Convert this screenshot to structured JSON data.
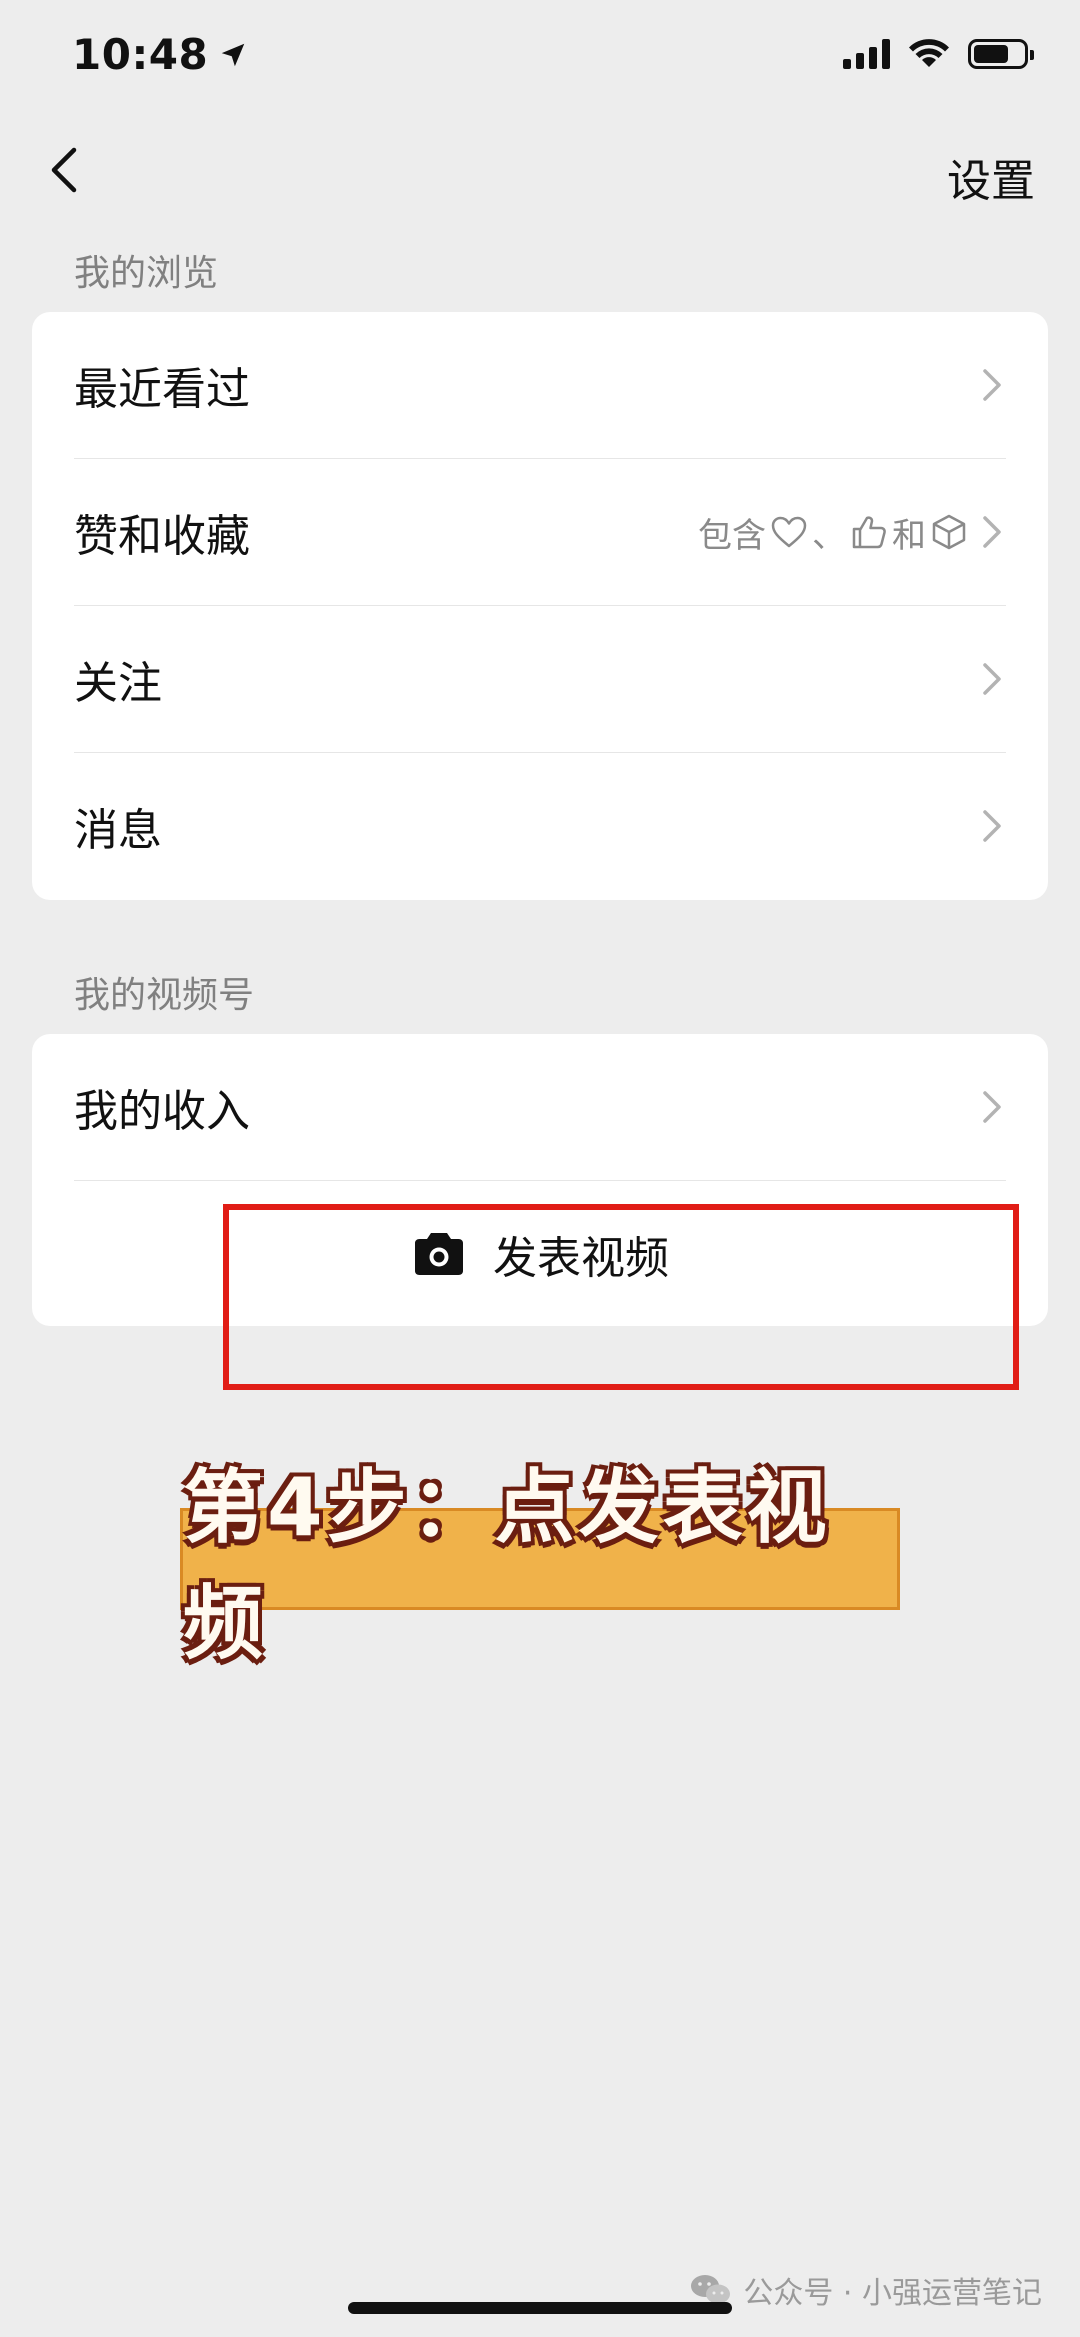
{
  "status_bar": {
    "time": "10:48"
  },
  "nav": {
    "right_label": "设置"
  },
  "sections": {
    "browse_title": "我的浏览",
    "browse_items": [
      {
        "label": "最近看过"
      },
      {
        "label": "赞和收藏",
        "hint_prefix": "包含",
        "hint_sep": "、",
        "hint_and": "和"
      },
      {
        "label": "关注"
      },
      {
        "label": "消息"
      }
    ],
    "channels_title": "我的视频号",
    "income_label": "我的收入",
    "publish_label": "发表视频"
  },
  "overlay": {
    "caption": "第4步：点发表视频"
  },
  "watermark": {
    "text": "公众号 · 小强运营笔记"
  },
  "colors": {
    "background": "#ededed",
    "card": "#ffffff",
    "highlight": "#e11d16",
    "caption_fill": "#f0b24a"
  }
}
